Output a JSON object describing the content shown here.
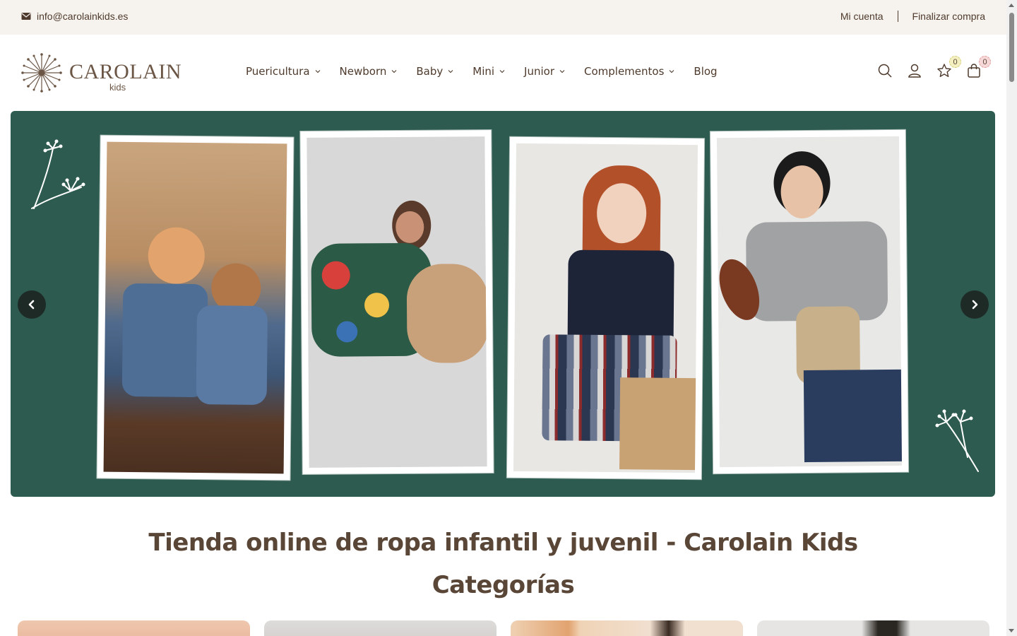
{
  "topbar": {
    "email": "info@carolainkids.es",
    "account_link": "Mi cuenta",
    "checkout_link": "Finalizar compra",
    "email_icon": "envelope-icon"
  },
  "header": {
    "logo_brand": "CAROLAIN",
    "logo_sub": "kids",
    "nav": [
      {
        "label": "Puericultura",
        "has_dropdown": true
      },
      {
        "label": "Newborn",
        "has_dropdown": true
      },
      {
        "label": "Baby",
        "has_dropdown": true
      },
      {
        "label": "Mini",
        "has_dropdown": true
      },
      {
        "label": "Junior",
        "has_dropdown": true
      },
      {
        "label": "Complementos",
        "has_dropdown": true
      },
      {
        "label": "Blog",
        "has_dropdown": false
      }
    ],
    "icons": {
      "search": "search-icon",
      "account": "user-icon",
      "wishlist": "star-icon",
      "cart": "bag-icon"
    },
    "wishlist_count": "0",
    "cart_count": "0"
  },
  "hero": {
    "background": "#2e5b4f",
    "prev_icon": "chevron-left-icon",
    "next_icon": "chevron-right-icon",
    "slides_visible": 4
  },
  "main": {
    "title": "Tienda online de ropa infantil y juvenil - Carolain Kids",
    "subtitle": "Categorías"
  },
  "colors": {
    "brand_text": "#5a4636",
    "topbar_bg": "#f6f3ef",
    "hero_bg": "#2e5b4f"
  }
}
